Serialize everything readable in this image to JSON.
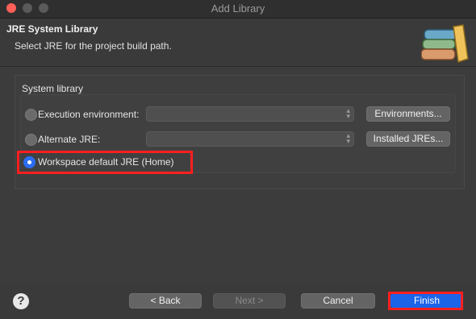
{
  "window": {
    "title": "Add Library"
  },
  "header": {
    "title": "JRE System Library",
    "description": "Select JRE for the project build path.",
    "icon": "library-books-icon"
  },
  "group": {
    "label": "System library",
    "options": [
      {
        "label": "Execution environment:",
        "selected": false,
        "button": "Environments..."
      },
      {
        "label": "Alternate JRE:",
        "selected": false,
        "button": "Installed JREs..."
      },
      {
        "label": "Workspace default JRE (Home)",
        "selected": true
      }
    ]
  },
  "footer": {
    "help_icon": "question-icon",
    "back_label": "< Back",
    "next_label": "Next >",
    "cancel_label": "Cancel",
    "finish_label": "Finish"
  },
  "colors": {
    "accent": "#1b64e8",
    "highlight": "#ff1f1f"
  }
}
